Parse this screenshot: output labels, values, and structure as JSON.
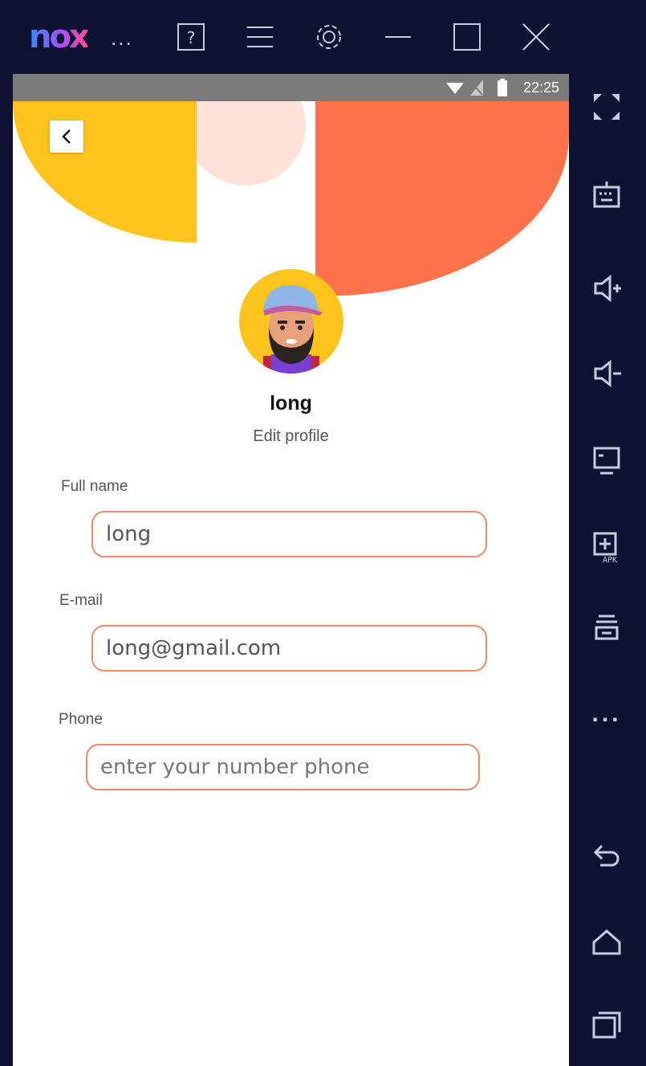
{
  "titlebar": {
    "logo_text": "nox",
    "ellipsis": "...",
    "icons": [
      "help-icon",
      "menu-icon",
      "settings-icon",
      "minimize-icon",
      "maximize-icon",
      "close-icon",
      "collapse-icon"
    ]
  },
  "sidebar": {
    "icons": [
      "fullscreen-icon",
      "keyboard-icon",
      "volume-up-icon",
      "volume-down-icon",
      "screen-icon",
      "apk-install-icon",
      "toolbox-icon",
      "more-icon",
      "android-back-icon",
      "android-home-icon",
      "android-recents-icon"
    ],
    "more_label": "..."
  },
  "statusbar": {
    "time": "22:25"
  },
  "profile": {
    "name": "long",
    "subtitle": "Edit profile"
  },
  "form": {
    "full_name_label": "Full name",
    "full_name_value": "long",
    "email_label": "E-mail",
    "email_value": "long@gmail.com",
    "phone_label": "Phone",
    "phone_placeholder": "enter your number phone"
  },
  "colors": {
    "emulator_bg": "#0e1130",
    "yellow": "#ffc31e",
    "orange": "#ff734c",
    "pink": "#ffe1d9",
    "field_border": "#f2896a"
  }
}
